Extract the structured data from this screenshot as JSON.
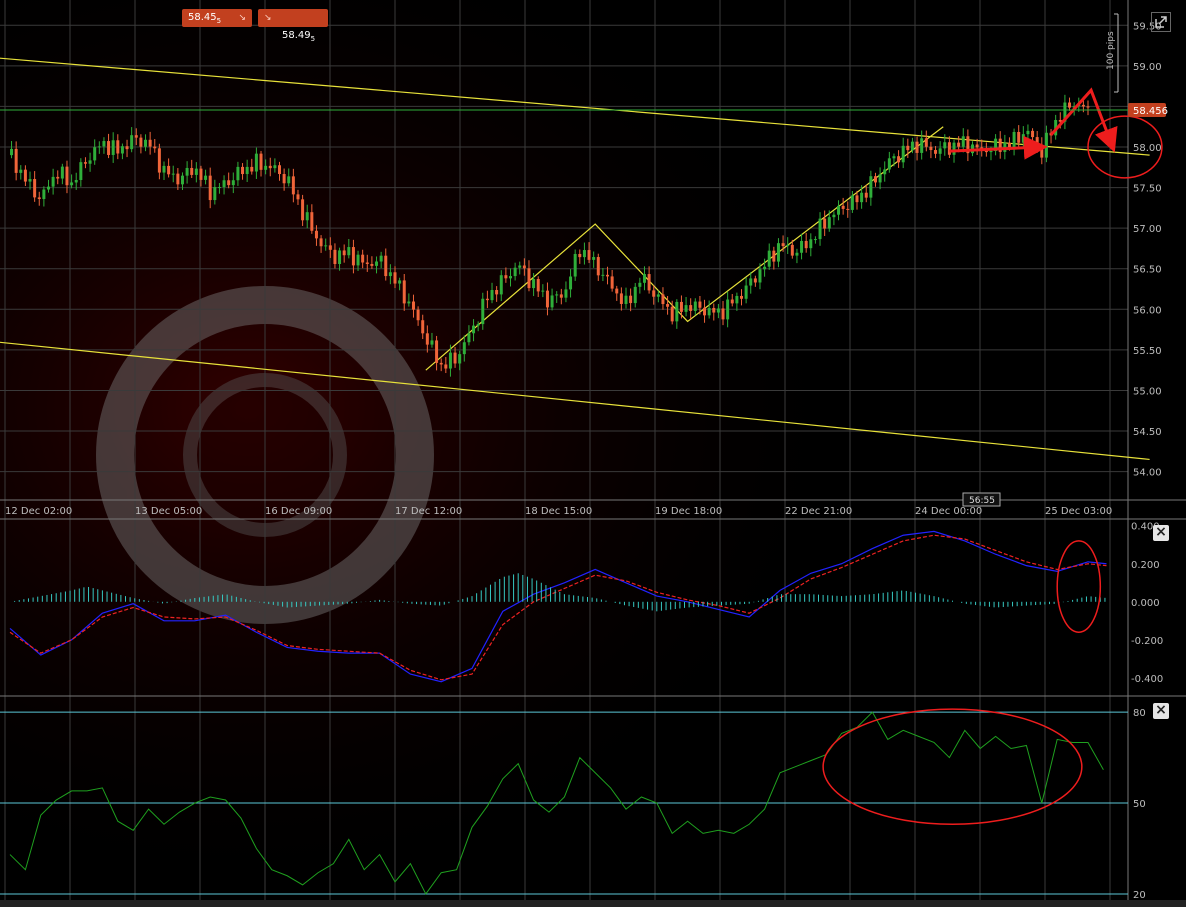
{
  "toolbar": {
    "sell_price": "58.45",
    "sell_price_sup": "5",
    "buy_price": "58.49",
    "buy_price_sup": "5",
    "close_icon_1": "close-icon",
    "close_icon_2": "close-icon",
    "expand_icon": "expand-icon",
    "close_glyph": "×"
  },
  "chart_data": [
    {
      "type": "candlestick",
      "name": "price",
      "scale_label": "100 pips",
      "current_price": "58.456",
      "countdown": "56:55",
      "x_tick_labels": [
        "12 Dec 02:00",
        "13 Dec 05:00",
        "16 Dec 09:00",
        "17 Dec 12:00",
        "18 Dec 15:00",
        "19 Dec 18:00",
        "22 Dec 21:00",
        "24 Dec 00:00",
        "25 Dec 03:00"
      ],
      "y_tick_labels": [
        "59.50",
        "59.00",
        "58.50",
        "58.00",
        "57.50",
        "57.00",
        "56.50",
        "56.00",
        "55.50",
        "55.00",
        "54.50",
        "54.00"
      ],
      "ylim": [
        53.65,
        59.75
      ],
      "close_path": [
        [
          0,
          57.9
        ],
        [
          5,
          57.6
        ],
        [
          10,
          57.35
        ],
        [
          15,
          57.7
        ],
        [
          20,
          57.55
        ],
        [
          25,
          57.85
        ],
        [
          30,
          58.05
        ],
        [
          35,
          57.95
        ],
        [
          40,
          58.1
        ],
        [
          45,
          58.05
        ],
        [
          50,
          57.7
        ],
        [
          55,
          57.6
        ],
        [
          60,
          57.75
        ],
        [
          65,
          57.45
        ],
        [
          70,
          57.55
        ],
        [
          75,
          57.7
        ],
        [
          80,
          57.8
        ],
        [
          85,
          57.75
        ],
        [
          90,
          57.6
        ],
        [
          95,
          57.2
        ],
        [
          100,
          56.85
        ],
        [
          105,
          56.65
        ],
        [
          110,
          56.7
        ],
        [
          115,
          56.55
        ],
        [
          120,
          56.6
        ],
        [
          125,
          56.35
        ],
        [
          130,
          56.05
        ],
        [
          135,
          55.65
        ],
        [
          140,
          55.3
        ],
        [
          145,
          55.4
        ],
        [
          150,
          55.75
        ],
        [
          155,
          56.15
        ],
        [
          160,
          56.35
        ],
        [
          165,
          56.55
        ],
        [
          170,
          56.3
        ],
        [
          175,
          56.1
        ],
        [
          180,
          56.2
        ],
        [
          185,
          56.75
        ],
        [
          190,
          56.55
        ],
        [
          195,
          56.3
        ],
        [
          200,
          56.05
        ],
        [
          205,
          56.4
        ],
        [
          210,
          56.15
        ],
        [
          215,
          55.95
        ],
        [
          220,
          56.05
        ],
        [
          225,
          56.0
        ],
        [
          230,
          55.95
        ],
        [
          235,
          56.1
        ],
        [
          240,
          56.3
        ],
        [
          245,
          56.55
        ],
        [
          250,
          56.8
        ],
        [
          255,
          56.7
        ],
        [
          260,
          56.85
        ],
        [
          265,
          57.1
        ],
        [
          270,
          57.25
        ],
        [
          275,
          57.35
        ],
        [
          280,
          57.55
        ],
        [
          285,
          57.8
        ],
        [
          290,
          57.95
        ],
        [
          295,
          58.05
        ],
        [
          300,
          57.95
        ],
        [
          305,
          58.0
        ],
        [
          310,
          58.05
        ],
        [
          315,
          57.95
        ],
        [
          320,
          58.0
        ],
        [
          325,
          58.05
        ],
        [
          330,
          58.2
        ],
        [
          335,
          57.95
        ],
        [
          340,
          58.35
        ],
        [
          345,
          58.55
        ],
        [
          350,
          58.45
        ]
      ],
      "trend_lines": [
        {
          "name": "upper-channel",
          "from": [
            -5,
            59.1
          ],
          "to": [
            370,
            57.9
          ]
        },
        {
          "name": "lower-channel",
          "from": [
            -5,
            55.6
          ],
          "to": [
            370,
            54.15
          ]
        },
        {
          "name": "zigzag",
          "points": [
            [
              135,
              55.25
            ],
            [
              190,
              57.05
            ],
            [
              220,
              55.85
            ],
            [
              303,
              58.25
            ]
          ]
        }
      ],
      "annotations": [
        {
          "type": "arrow",
          "points": [
            [
              305,
              57.95
            ],
            [
              335,
              58.0
            ]
          ]
        },
        {
          "type": "arrow",
          "points": [
            [
              338,
              58.15
            ],
            [
              351,
              58.7
            ],
            [
              358,
              58.0
            ]
          ]
        },
        {
          "type": "ellipse",
          "center": [
            362,
            58.0
          ],
          "radius": [
            12,
            0.38
          ]
        }
      ]
    },
    {
      "type": "line",
      "name": "macd",
      "y_tick_labels": [
        "0.400",
        "0.200",
        "0.000",
        "-0.200",
        "-0.400"
      ],
      "ylim": [
        -0.49,
        0.43
      ],
      "series": [
        {
          "name": "",
          "color": "#2222ff",
          "values": [
            [
              0,
              -0.14
            ],
            [
              10,
              -0.28
            ],
            [
              20,
              -0.2
            ],
            [
              30,
              -0.06
            ],
            [
              40,
              -0.01
            ],
            [
              50,
              -0.1
            ],
            [
              60,
              -0.1
            ],
            [
              70,
              -0.07
            ],
            [
              80,
              -0.16
            ],
            [
              90,
              -0.24
            ],
            [
              100,
              -0.26
            ],
            [
              110,
              -0.27
            ],
            [
              120,
              -0.27
            ],
            [
              130,
              -0.38
            ],
            [
              140,
              -0.42
            ],
            [
              150,
              -0.35
            ],
            [
              160,
              -0.05
            ],
            [
              170,
              0.04
            ],
            [
              180,
              0.1
            ],
            [
              190,
              0.17
            ],
            [
              200,
              0.1
            ],
            [
              210,
              0.03
            ],
            [
              220,
              0.0
            ],
            [
              230,
              -0.04
            ],
            [
              240,
              -0.08
            ],
            [
              250,
              0.06
            ],
            [
              260,
              0.15
            ],
            [
              270,
              0.2
            ],
            [
              280,
              0.28
            ],
            [
              290,
              0.35
            ],
            [
              300,
              0.37
            ],
            [
              310,
              0.32
            ],
            [
              320,
              0.25
            ],
            [
              330,
              0.19
            ],
            [
              340,
              0.16
            ],
            [
              350,
              0.21
            ],
            [
              356,
              0.2
            ]
          ]
        },
        {
          "name": "",
          "color": "#ee2222",
          "values": [
            [
              0,
              -0.16
            ],
            [
              10,
              -0.27
            ],
            [
              20,
              -0.2
            ],
            [
              30,
              -0.08
            ],
            [
              40,
              -0.03
            ],
            [
              50,
              -0.08
            ],
            [
              60,
              -0.09
            ],
            [
              70,
              -0.08
            ],
            [
              80,
              -0.15
            ],
            [
              90,
              -0.23
            ],
            [
              100,
              -0.25
            ],
            [
              110,
              -0.26
            ],
            [
              120,
              -0.27
            ],
            [
              130,
              -0.36
            ],
            [
              140,
              -0.41
            ],
            [
              150,
              -0.38
            ],
            [
              160,
              -0.12
            ],
            [
              170,
              0.0
            ],
            [
              180,
              0.07
            ],
            [
              190,
              0.14
            ],
            [
              200,
              0.11
            ],
            [
              210,
              0.05
            ],
            [
              220,
              0.01
            ],
            [
              230,
              -0.02
            ],
            [
              240,
              -0.06
            ],
            [
              250,
              0.02
            ],
            [
              260,
              0.12
            ],
            [
              270,
              0.18
            ],
            [
              280,
              0.25
            ],
            [
              290,
              0.32
            ],
            [
              300,
              0.35
            ],
            [
              310,
              0.33
            ],
            [
              320,
              0.27
            ],
            [
              330,
              0.21
            ],
            [
              340,
              0.17
            ],
            [
              350,
              0.2
            ],
            [
              356,
              0.19
            ]
          ]
        },
        {
          "name": "",
          "color": "#36c9c2",
          "type": "histogram",
          "values": [
            [
              0,
              0.0
            ],
            [
              10,
              0.03
            ],
            [
              20,
              0.06
            ],
            [
              25,
              0.08
            ],
            [
              30,
              0.06
            ],
            [
              40,
              0.02
            ],
            [
              50,
              -0.01
            ],
            [
              60,
              0.02
            ],
            [
              70,
              0.04
            ],
            [
              80,
              0.0
            ],
            [
              90,
              -0.03
            ],
            [
              100,
              -0.02
            ],
            [
              110,
              -0.01
            ],
            [
              120,
              0.01
            ],
            [
              130,
              -0.01
            ],
            [
              140,
              -0.02
            ],
            [
              150,
              0.03
            ],
            [
              160,
              0.13
            ],
            [
              165,
              0.15
            ],
            [
              170,
              0.12
            ],
            [
              180,
              0.04
            ],
            [
              190,
              0.02
            ],
            [
              200,
              -0.02
            ],
            [
              210,
              -0.05
            ],
            [
              220,
              -0.03
            ],
            [
              230,
              -0.02
            ],
            [
              240,
              -0.01
            ],
            [
              250,
              0.04
            ],
            [
              260,
              0.04
            ],
            [
              270,
              0.03
            ],
            [
              280,
              0.04
            ],
            [
              290,
              0.06
            ],
            [
              300,
              0.03
            ],
            [
              310,
              -0.01
            ],
            [
              320,
              -0.03
            ],
            [
              330,
              -0.02
            ],
            [
              340,
              -0.01
            ],
            [
              350,
              0.03
            ],
            [
              356,
              0.02
            ]
          ]
        }
      ],
      "annotations": [
        {
          "type": "ellipse",
          "center": [
            347,
            0.08
          ],
          "radius": [
            7,
            0.24
          ]
        }
      ]
    },
    {
      "type": "line",
      "name": "rsi",
      "y_tick_labels": [
        "80",
        "50",
        "20"
      ],
      "ylim": [
        18,
        85
      ],
      "levels": [
        80,
        50,
        20
      ],
      "series": [
        {
          "name": "",
          "color": "#1fa01f",
          "values": [
            [
              0,
              33
            ],
            [
              5,
              28
            ],
            [
              10,
              46
            ],
            [
              15,
              51
            ],
            [
              20,
              54
            ],
            [
              25,
              54
            ],
            [
              30,
              55
            ],
            [
              35,
              44
            ],
            [
              40,
              41
            ],
            [
              45,
              48
            ],
            [
              50,
              43
            ],
            [
              55,
              47
            ],
            [
              60,
              50
            ],
            [
              65,
              52
            ],
            [
              70,
              51
            ],
            [
              75,
              45
            ],
            [
              80,
              35
            ],
            [
              85,
              28
            ],
            [
              90,
              26
            ],
            [
              95,
              23
            ],
            [
              100,
              27
            ],
            [
              105,
              30
            ],
            [
              110,
              38
            ],
            [
              115,
              28
            ],
            [
              120,
              33
            ],
            [
              125,
              24
            ],
            [
              130,
              30
            ],
            [
              135,
              20
            ],
            [
              140,
              27
            ],
            [
              145,
              28
            ],
            [
              150,
              42
            ],
            [
              155,
              49
            ],
            [
              160,
              58
            ],
            [
              165,
              63
            ],
            [
              170,
              51
            ],
            [
              175,
              47
            ],
            [
              180,
              52
            ],
            [
              185,
              65
            ],
            [
              190,
              60
            ],
            [
              195,
              55
            ],
            [
              200,
              48
            ],
            [
              205,
              52
            ],
            [
              210,
              50
            ],
            [
              215,
              40
            ],
            [
              220,
              44
            ],
            [
              225,
              40
            ],
            [
              230,
              41
            ],
            [
              235,
              40
            ],
            [
              240,
              43
            ],
            [
              245,
              48
            ],
            [
              250,
              60
            ],
            [
              255,
              62
            ],
            [
              260,
              64
            ],
            [
              265,
              66
            ],
            [
              270,
              73
            ],
            [
              275,
              75
            ],
            [
              280,
              80
            ],
            [
              285,
              71
            ],
            [
              290,
              74
            ],
            [
              295,
              72
            ],
            [
              300,
              70
            ],
            [
              305,
              65
            ],
            [
              310,
              74
            ],
            [
              315,
              68
            ],
            [
              320,
              72
            ],
            [
              325,
              68
            ],
            [
              330,
              69
            ],
            [
              335,
              50
            ],
            [
              340,
              71
            ],
            [
              345,
              70
            ],
            [
              350,
              70
            ],
            [
              355,
              61
            ]
          ]
        }
      ],
      "annotations": [
        {
          "type": "ellipse",
          "center": [
            306,
            62
          ],
          "radius": [
            42,
            19
          ]
        }
      ]
    }
  ]
}
